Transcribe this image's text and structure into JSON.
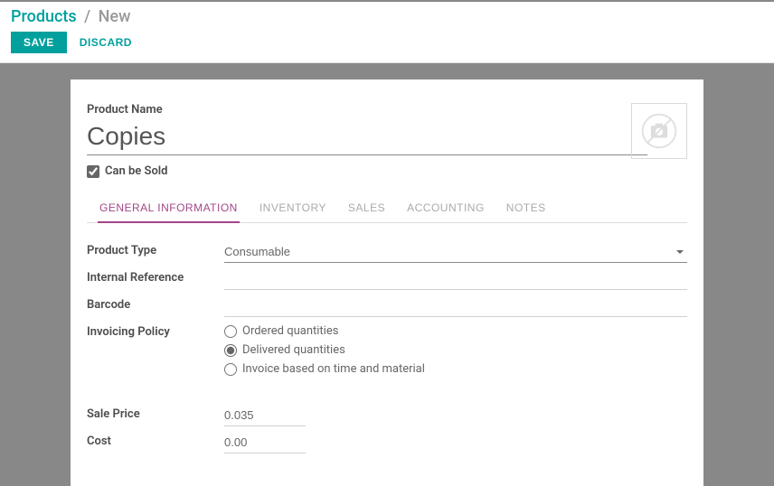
{
  "breadcrumb": {
    "root": "Products",
    "current": "New"
  },
  "toolbar": {
    "save": "SAVE",
    "discard": "DISCARD"
  },
  "product": {
    "name_label": "Product Name",
    "name_value": "Copies",
    "can_be_sold_label": "Can be Sold",
    "can_be_sold": true
  },
  "tabs": {
    "general": "GENERAL INFORMATION",
    "inventory": "INVENTORY",
    "sales": "SALES",
    "accounting": "ACCOUNTING",
    "notes": "NOTES"
  },
  "fields": {
    "product_type_label": "Product Type",
    "product_type_value": "Consumable",
    "internal_ref_label": "Internal Reference",
    "internal_ref_value": "",
    "barcode_label": "Barcode",
    "barcode_value": "",
    "invoicing_label": "Invoicing Policy",
    "invoicing_options": {
      "ordered": "Ordered quantities",
      "delivered": "Delivered quantities",
      "time_material": "Invoice based on time and material"
    },
    "invoicing_selected": "delivered",
    "sale_price_label": "Sale Price",
    "sale_price_value": "0.035",
    "cost_label": "Cost",
    "cost_value": "0.00"
  }
}
